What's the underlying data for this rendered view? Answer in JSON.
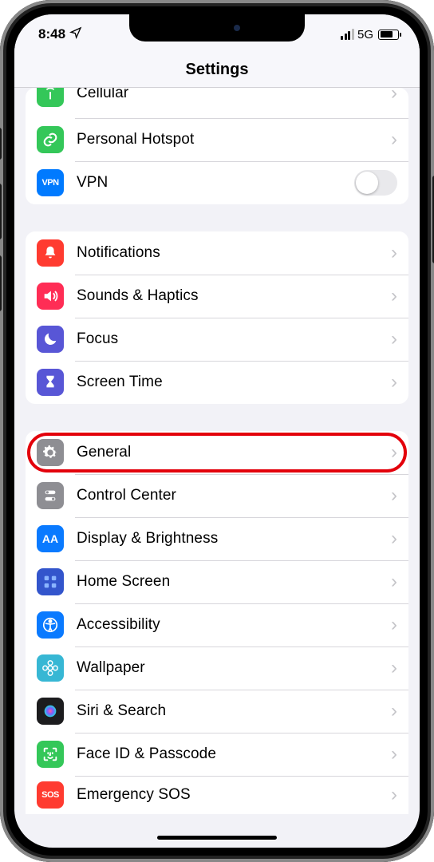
{
  "status": {
    "time": "8:48",
    "network": "5G"
  },
  "header": {
    "title": "Settings"
  },
  "groups": [
    {
      "rows": [
        {
          "key": "cellular",
          "label": "Cellular",
          "icon": "antenna-icon",
          "icon_bg": "#34c759",
          "accessory": "chevron",
          "cut": true
        },
        {
          "key": "hotspot",
          "label": "Personal Hotspot",
          "icon": "link-icon",
          "icon_bg": "#34c759",
          "accessory": "chevron"
        },
        {
          "key": "vpn",
          "label": "VPN",
          "icon": "vpn-icon",
          "icon_bg": "#007aff",
          "icon_text": "VPN",
          "accessory": "toggle",
          "toggle_on": false
        }
      ]
    },
    {
      "rows": [
        {
          "key": "notifications",
          "label": "Notifications",
          "icon": "bell-icon",
          "icon_bg": "#ff3b30",
          "accessory": "chevron"
        },
        {
          "key": "sounds",
          "label": "Sounds & Haptics",
          "icon": "speaker-icon",
          "icon_bg": "#ff2d55",
          "accessory": "chevron"
        },
        {
          "key": "focus",
          "label": "Focus",
          "icon": "moon-icon",
          "icon_bg": "#5856d6",
          "accessory": "chevron"
        },
        {
          "key": "screentime",
          "label": "Screen Time",
          "icon": "hourglass-icon",
          "icon_bg": "#5856d6",
          "accessory": "chevron"
        }
      ]
    },
    {
      "rows": [
        {
          "key": "general",
          "label": "General",
          "icon": "gear-icon",
          "icon_bg": "#8e8e93",
          "accessory": "chevron",
          "highlighted": true
        },
        {
          "key": "controlcenter",
          "label": "Control Center",
          "icon": "switches-icon",
          "icon_bg": "#8e8e93",
          "accessory": "chevron"
        },
        {
          "key": "display",
          "label": "Display & Brightness",
          "icon": "text-size-icon",
          "icon_bg": "#0a7aff",
          "icon_text": "AA",
          "accessory": "chevron"
        },
        {
          "key": "homescreen",
          "label": "Home Screen",
          "icon": "grid-icon",
          "icon_bg": "#3355cc",
          "accessory": "chevron"
        },
        {
          "key": "accessibility",
          "label": "Accessibility",
          "icon": "accessibility-icon",
          "icon_bg": "#0a7aff",
          "accessory": "chevron"
        },
        {
          "key": "wallpaper",
          "label": "Wallpaper",
          "icon": "flower-icon",
          "icon_bg": "#37b7d4",
          "accessory": "chevron"
        },
        {
          "key": "siri",
          "label": "Siri & Search",
          "icon": "siri-icon",
          "icon_bg": "#1c1c1e",
          "accessory": "chevron"
        },
        {
          "key": "faceid",
          "label": "Face ID & Passcode",
          "icon": "faceid-icon",
          "icon_bg": "#34c759",
          "accessory": "chevron"
        },
        {
          "key": "sos",
          "label": "Emergency SOS",
          "icon": "sos-icon",
          "icon_bg": "#ff3b30",
          "icon_text": "SOS",
          "accessory": "chevron",
          "cut_bottom": true
        }
      ]
    }
  ]
}
